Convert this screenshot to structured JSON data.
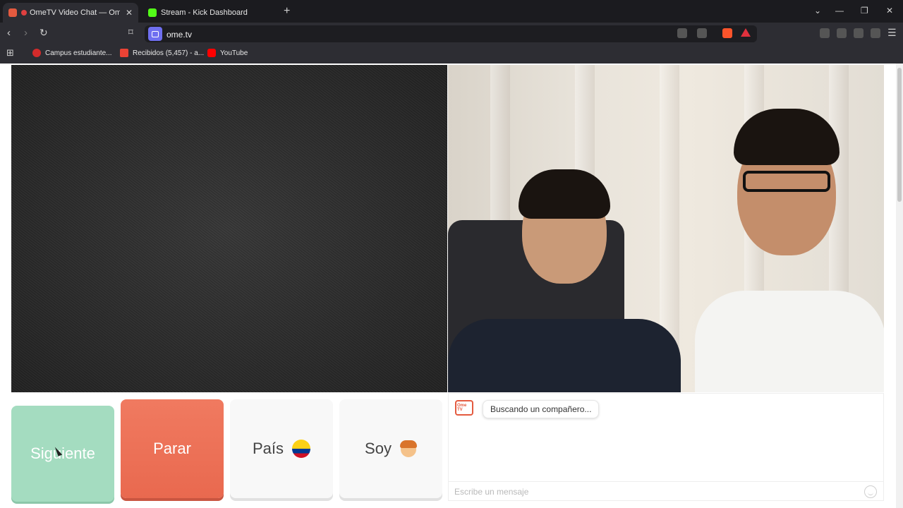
{
  "browser": {
    "tabs": [
      {
        "title": "OmeTV Video Chat — Omeg",
        "active": true
      },
      {
        "title": "Stream - Kick Dashboard",
        "active": false
      }
    ],
    "url": "ome.tv",
    "bookmarks": [
      "Campus estudiante...",
      "Recibidos (5,457) - a...",
      "YouTube"
    ]
  },
  "controls": {
    "next_label": "Siguiente",
    "stop_label": "Parar",
    "country_label": "País",
    "gender_label": "Soy"
  },
  "chat": {
    "logo_text": "Ome TV",
    "status_message": "Buscando un compañero...",
    "input_placeholder": "Escribe un mensaje"
  },
  "colors": {
    "next": "#a4dcc0",
    "stop": "#ec6f55",
    "accent": "#e45a3f"
  }
}
